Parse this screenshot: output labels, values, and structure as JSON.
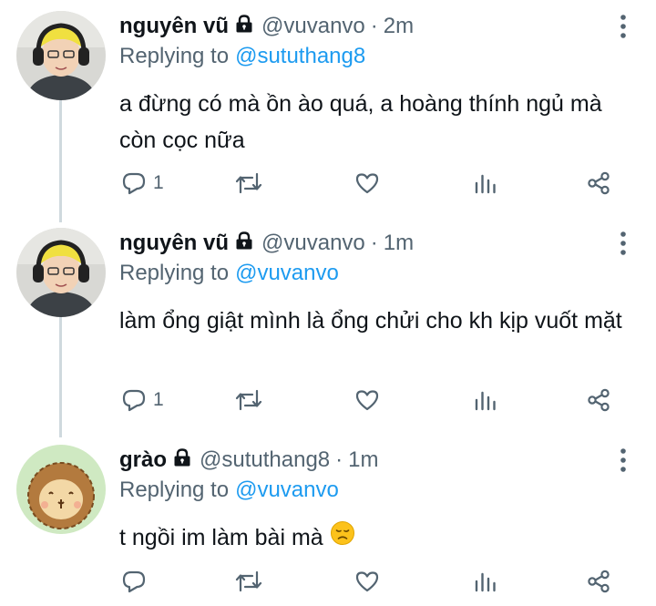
{
  "tweets": [
    {
      "name": "nguyên vũ",
      "handle": "@vuvanvo",
      "dot": "·",
      "time": "2m",
      "replying_label": "Replying to",
      "replying_to": "@sututhang8",
      "text": "a đừng có mà ồn ào quá, a hoàng thính ngủ mà còn cọc nữa",
      "reply_count": "1",
      "avatar": "person-with-headphones"
    },
    {
      "name": "nguyên vũ",
      "handle": "@vuvanvo",
      "dot": "·",
      "time": "1m",
      "replying_label": "Replying to",
      "replying_to": "@vuvanvo",
      "text": "làm ổng giật mình là ổng chửi cho kh kịp vuốt mặt",
      "reply_count": "1",
      "avatar": "person-with-headphones"
    },
    {
      "name": "grào",
      "handle": "@sututhang8",
      "dot": "·",
      "time": "1m",
      "replying_label": "Replying to",
      "replying_to": "@vuvanvo",
      "text": "t ngồi im làm bài mà",
      "emoji": "disappointed-face",
      "reply_count": "",
      "avatar": "cartoon-lion"
    }
  ],
  "colors": {
    "text": "#0f1419",
    "secondary": "#536471",
    "link": "#1d9bf0",
    "thread_line": "#cfd9de"
  },
  "icons": [
    "reply-icon",
    "retweet-icon",
    "like-icon",
    "stats-icon",
    "share-icon",
    "lock-icon",
    "more-icon"
  ]
}
